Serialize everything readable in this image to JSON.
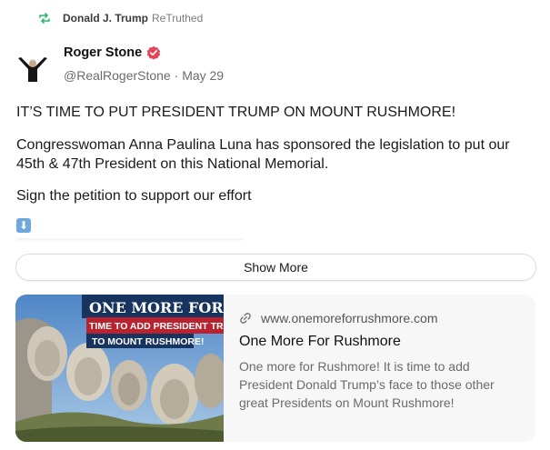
{
  "retruth": {
    "user": "Donald J. Trump",
    "label": "ReTruthed"
  },
  "author": {
    "display_name": "Roger Stone",
    "handle": "@RealRogerStone",
    "separator": " · ",
    "date": "May 29"
  },
  "post": {
    "paragraphs": [
      "IT’S TIME TO PUT PRESIDENT TRUMP ON MOUNT RUSHMORE!",
      "Congresswoman Anna Paulina Luna has sponsored the legislation to put our 45th & 47th President on this National Memorial.",
      "Sign the petition to support our effort"
    ],
    "arrow_emoji": "⬇"
  },
  "show_more_label": "Show More",
  "link_card": {
    "domain": "www.onemoreforrushmore.com",
    "title": "One More For Rushmore",
    "description": "One more for Rushmore! It is time to add President Donald Trump’s face to those other great Presidents on Mount Rushmore!",
    "image_banner": "ONE MORE FOR RUSHMO",
    "image_sub1": "TIME TO ADD PRESIDENT TRU",
    "image_sub2": "TO MOUNT RUSHMORE!"
  },
  "colors": {
    "retruth_green": "#2eb36b",
    "verified_red": "#e5445b",
    "banner_blue": "#17345f",
    "banner_red": "#b8232f"
  }
}
